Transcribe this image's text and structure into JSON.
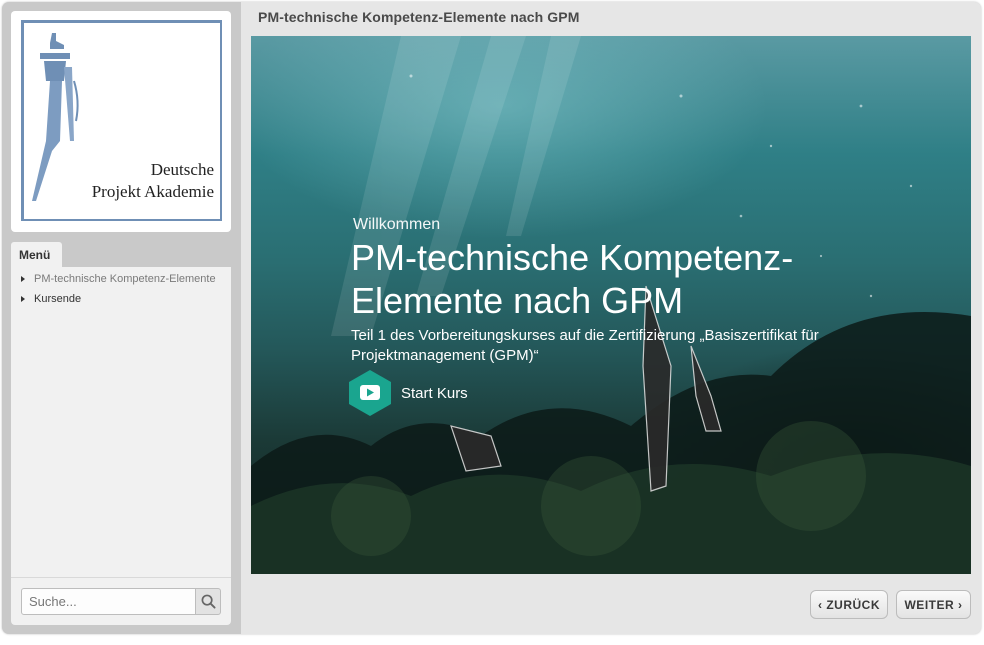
{
  "header": {
    "title": "PM-technische Kompetenz-Elemente nach GPM"
  },
  "logo": {
    "line1": "Deutsche",
    "line2": "Projekt Akademie"
  },
  "menu": {
    "tab_label": "Menü",
    "items": [
      {
        "label": "PM-technische Kompetenz-Elemente",
        "active": true
      },
      {
        "label": "Kursende",
        "active": false
      }
    ]
  },
  "search": {
    "placeholder": "Suche...",
    "icon": "search-icon"
  },
  "slide": {
    "welcome": "Willkommen",
    "title": "PM-technische Kompetenz-Elemente nach GPM",
    "subtitle": "Teil 1 des Vorbereitungskurses auf die Zertifizierung „Basiszertifikat für Projektmanagement (GPM)“",
    "start_label": "Start Kurs",
    "start_icon": "play-icon",
    "accent_color": "#1aa58f"
  },
  "nav": {
    "prev_label": "ZURÜCK",
    "next_label": "WEITER"
  }
}
